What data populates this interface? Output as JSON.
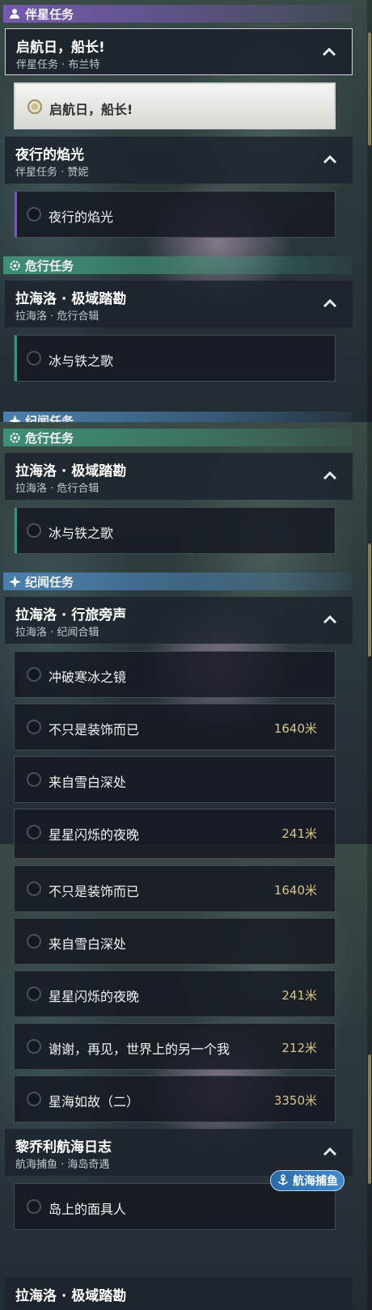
{
  "panel1": {
    "category_companion": "伴星任务",
    "group_qihang": {
      "title": "启航日，船长!",
      "subtitle": "伴星任务 · 布兰特"
    },
    "task_qihang": "启航日，船长!",
    "group_yexing": {
      "title": "夜行的焰光",
      "subtitle": "伴星任务 · 赞妮"
    },
    "task_yexing": "夜行的焰光",
    "category_danger": "危行任务",
    "group_lahailuo_danger": {
      "title": "拉海洛 · 极域踏勘",
      "subtitle": "拉海洛 · 危行合辑"
    },
    "task_bingyutie": "冰与铁之歌",
    "category_story_partial": "纪闻任务"
  },
  "panel2": {
    "category_danger": "危行任务",
    "group_lahailuo_danger": {
      "title": "拉海洛 · 极域踏勘",
      "subtitle": "拉海洛 · 危行合辑"
    },
    "task_bingyutie": "冰与铁之歌",
    "category_story": "纪闻任务",
    "group_lahailuo_story": {
      "title": "拉海洛 · 行旅旁声",
      "subtitle": "拉海洛 · 纪闻合辑"
    },
    "task_chongpo": "冲破寒冰之镜",
    "task_buzhishi": {
      "title": "不只是装饰而已",
      "distance": "1640米"
    },
    "task_laizi": "来自雪白深处",
    "task_xingxing_partial": {
      "title": "星星闪烁的夜晚",
      "distance": "241米"
    }
  },
  "panel3": {
    "task_buzhishi": {
      "title": "不只是装饰而已",
      "distance": "1640米"
    },
    "task_laizi": "来自雪白深处",
    "task_xingxing": {
      "title": "星星闪烁的夜晚",
      "distance": "241米"
    },
    "task_xiexie": {
      "title": "谢谢，再见，世界上的另一个我",
      "distance": "212米"
    },
    "task_xinghai": {
      "title": "星海如故（二）",
      "distance": "3350米"
    },
    "group_liqiaoli": {
      "title": "黎乔利航海日志",
      "subtitle": "航海捕鱼 · 海岛奇遇"
    },
    "task_daoshang": "岛上的面具人",
    "badge_fishing": "航海捕鱼",
    "group_lahailuo_partial": "拉海洛 · 极域踏勘"
  },
  "colors": {
    "companion": "#7659b0",
    "danger": "#3f8f78",
    "story": "#4a7fae",
    "distance": "#d6c48e",
    "active_task": "#f4f4f0"
  },
  "icons": {
    "companion": "person-icon",
    "danger": "gear-icon",
    "story": "sparkle-icon",
    "expand": "chevron-up-icon",
    "fishing": "anchor-icon"
  }
}
